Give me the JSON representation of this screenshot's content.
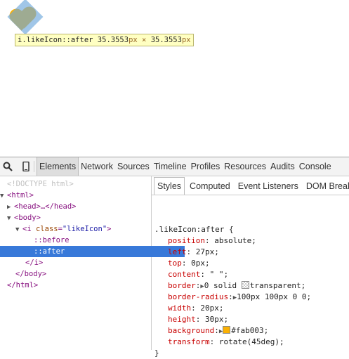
{
  "viewport": {
    "tooltip": {
      "selector": "i.likeIcon::after",
      "width": "35.3553",
      "height": "35.3553",
      "unit": "px",
      "times": "×"
    }
  },
  "toolbar": {
    "tabs": [
      "Elements",
      "Network",
      "Sources",
      "Timeline",
      "Profiles",
      "Resources",
      "Audits",
      "Console"
    ],
    "active_tab": "Elements"
  },
  "dom_tree": {
    "doctype": "<!DOCTYPE html>",
    "html_open": "<html>",
    "head": "<head>…</head>",
    "body_open": "<body>",
    "i_open_tag": "<i",
    "i_attr_name": "class",
    "i_attr_value": "\"likeIcon\"",
    "i_open_close": ">",
    "before": "::before",
    "after": "::after",
    "i_close": "</i>",
    "body_close": "</body>",
    "html_close": "</html>"
  },
  "styles_panel": {
    "subtabs": [
      "Styles",
      "Computed",
      "Event Listeners",
      "DOM Breakpoints"
    ],
    "active_subtab": "Styles",
    "selector": ".likeIcon:after {",
    "close_brace": "}",
    "declarations": [
      {
        "prop": "position",
        "value": "absolute;"
      },
      {
        "prop": "left",
        "value": "27px;"
      },
      {
        "prop": "top",
        "value": "0px;"
      },
      {
        "prop": "content",
        "value": "\" \";"
      },
      {
        "prop": "border",
        "value": "0 solid ",
        "value2": "transparent;"
      },
      {
        "prop": "border-radius",
        "value": "100px 100px 0 0;"
      },
      {
        "prop": "width",
        "value": "20px;"
      },
      {
        "prop": "height",
        "value": "30px;"
      },
      {
        "prop": "background",
        "value": "#fab003;"
      },
      {
        "prop": "transform",
        "value": "rotate(45deg);"
      }
    ]
  },
  "colors": {
    "like_icon": "#fab003",
    "selection": "#3879d9"
  }
}
